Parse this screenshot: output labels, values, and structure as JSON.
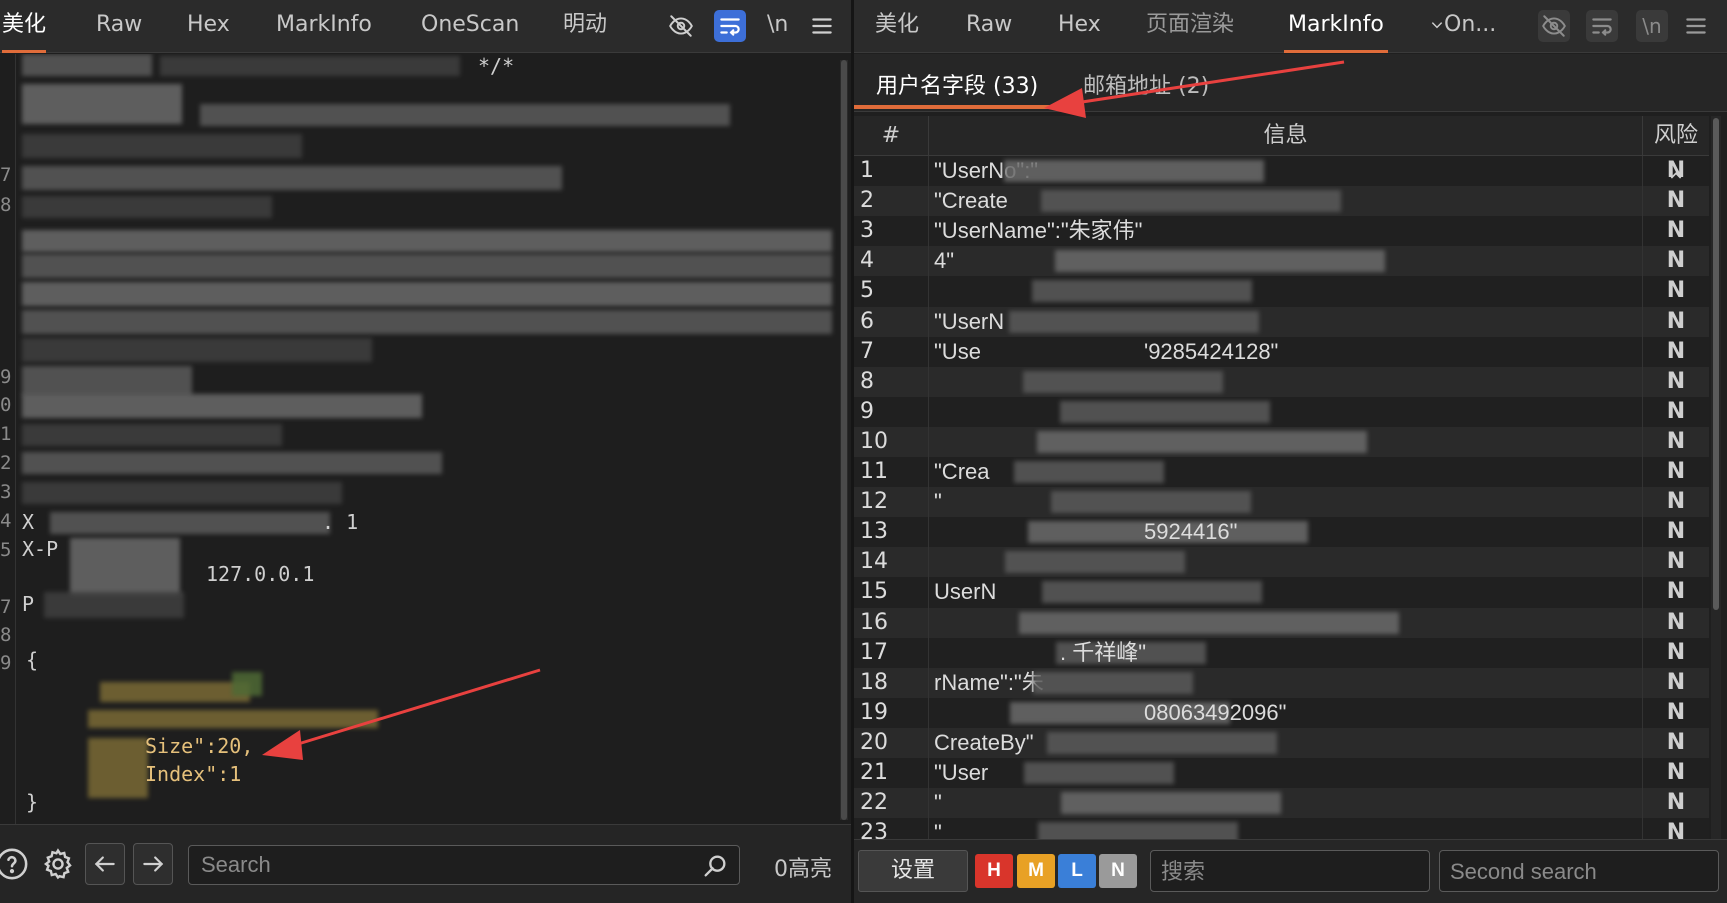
{
  "left_pane": {
    "tabs": [
      "美化",
      "Raw",
      "Hex",
      "MarkInfo",
      "OneScan",
      "明动"
    ],
    "toolbar": {
      "wrap_label": "\\n"
    },
    "editor": {
      "line_numbers": [
        "7",
        "8",
        "9",
        "0",
        "1",
        "2",
        "3",
        "4",
        "5",
        "7",
        "8",
        "9"
      ],
      "comment_fragment": "*/*",
      "ip_fragment": "127.0.0.1",
      "brace_open": "{",
      "brace_close": "}",
      "page_size_line": "Size\":20,",
      "page_index_line": "Index\":1",
      "fragment_x1": "X",
      "fragment_x2": "X-P",
      "fragment_one": ". 1",
      "fragment_p": "P"
    },
    "bottom": {
      "search_placeholder": "Search",
      "highlight_count": "0高亮"
    }
  },
  "right_pane": {
    "tabs": [
      "美化",
      "Raw",
      "Hex",
      "页面渲染",
      "MarkInfo",
      "On..."
    ],
    "active_tab": "MarkInfo",
    "toolbar": {
      "wrap_label": "\\n"
    },
    "subtabs": [
      {
        "label": "用户名字段 (33)",
        "active": true
      },
      {
        "label": "邮箱地址 (2)",
        "active": false
      }
    ],
    "table": {
      "headers": {
        "index": "#",
        "info": "信息",
        "risk": "风险"
      },
      "rows": [
        {
          "idx": "1",
          "info": "\"UserNo\":\"",
          "risk": "N"
        },
        {
          "idx": "2",
          "info": "\"Create",
          "risk": "N"
        },
        {
          "idx": "3",
          "info": "\"UserName\":\"朱家伟\"",
          "risk": "N"
        },
        {
          "idx": "4",
          "info": "4\"",
          "risk": "N"
        },
        {
          "idx": "5",
          "info": "",
          "risk": "N"
        },
        {
          "idx": "6",
          "info": "\"UserN",
          "risk": "N"
        },
        {
          "idx": "7",
          "info": "\"Use",
          "risk": "N",
          "tail": "'9285424128\""
        },
        {
          "idx": "8",
          "info": "",
          "risk": "N"
        },
        {
          "idx": "9",
          "info": "",
          "risk": "N"
        },
        {
          "idx": "10",
          "info": "",
          "risk": "N"
        },
        {
          "idx": "11",
          "info": "\"Crea",
          "risk": "N"
        },
        {
          "idx": "12",
          "info": "\"",
          "risk": "N"
        },
        {
          "idx": "13",
          "info": "",
          "risk": "N",
          "tail": "5924416\""
        },
        {
          "idx": "14",
          "info": "",
          "risk": "N"
        },
        {
          "idx": "15",
          "info": "UserN",
          "risk": "N"
        },
        {
          "idx": "16",
          "info": "",
          "risk": "N"
        },
        {
          "idx": "17",
          "info": "",
          "risk": "N",
          "tail": ". 千祥峰\""
        },
        {
          "idx": "18",
          "info": "rName\":\"朱",
          "risk": "N"
        },
        {
          "idx": "19",
          "info": "",
          "risk": "N",
          "tail": "08063492096\""
        },
        {
          "idx": "20",
          "info": "CreateBy\"",
          "risk": "N"
        },
        {
          "idx": "21",
          "info": "\"User",
          "risk": "N"
        },
        {
          "idx": "22",
          "info": "\"",
          "risk": "N"
        },
        {
          "idx": "23",
          "info": "\"",
          "risk": "N"
        }
      ]
    },
    "bottom": {
      "settings_label": "设置",
      "levels": [
        {
          "label": "H",
          "color": "#d9352b"
        },
        {
          "label": "M",
          "color": "#e8a125"
        },
        {
          "label": "L",
          "color": "#3a7fd8"
        },
        {
          "label": "N",
          "color": "#9a9a9a"
        }
      ],
      "search_placeholder": "搜索",
      "second_search_placeholder": "Second search"
    }
  },
  "annotation_color": "#e8413f"
}
